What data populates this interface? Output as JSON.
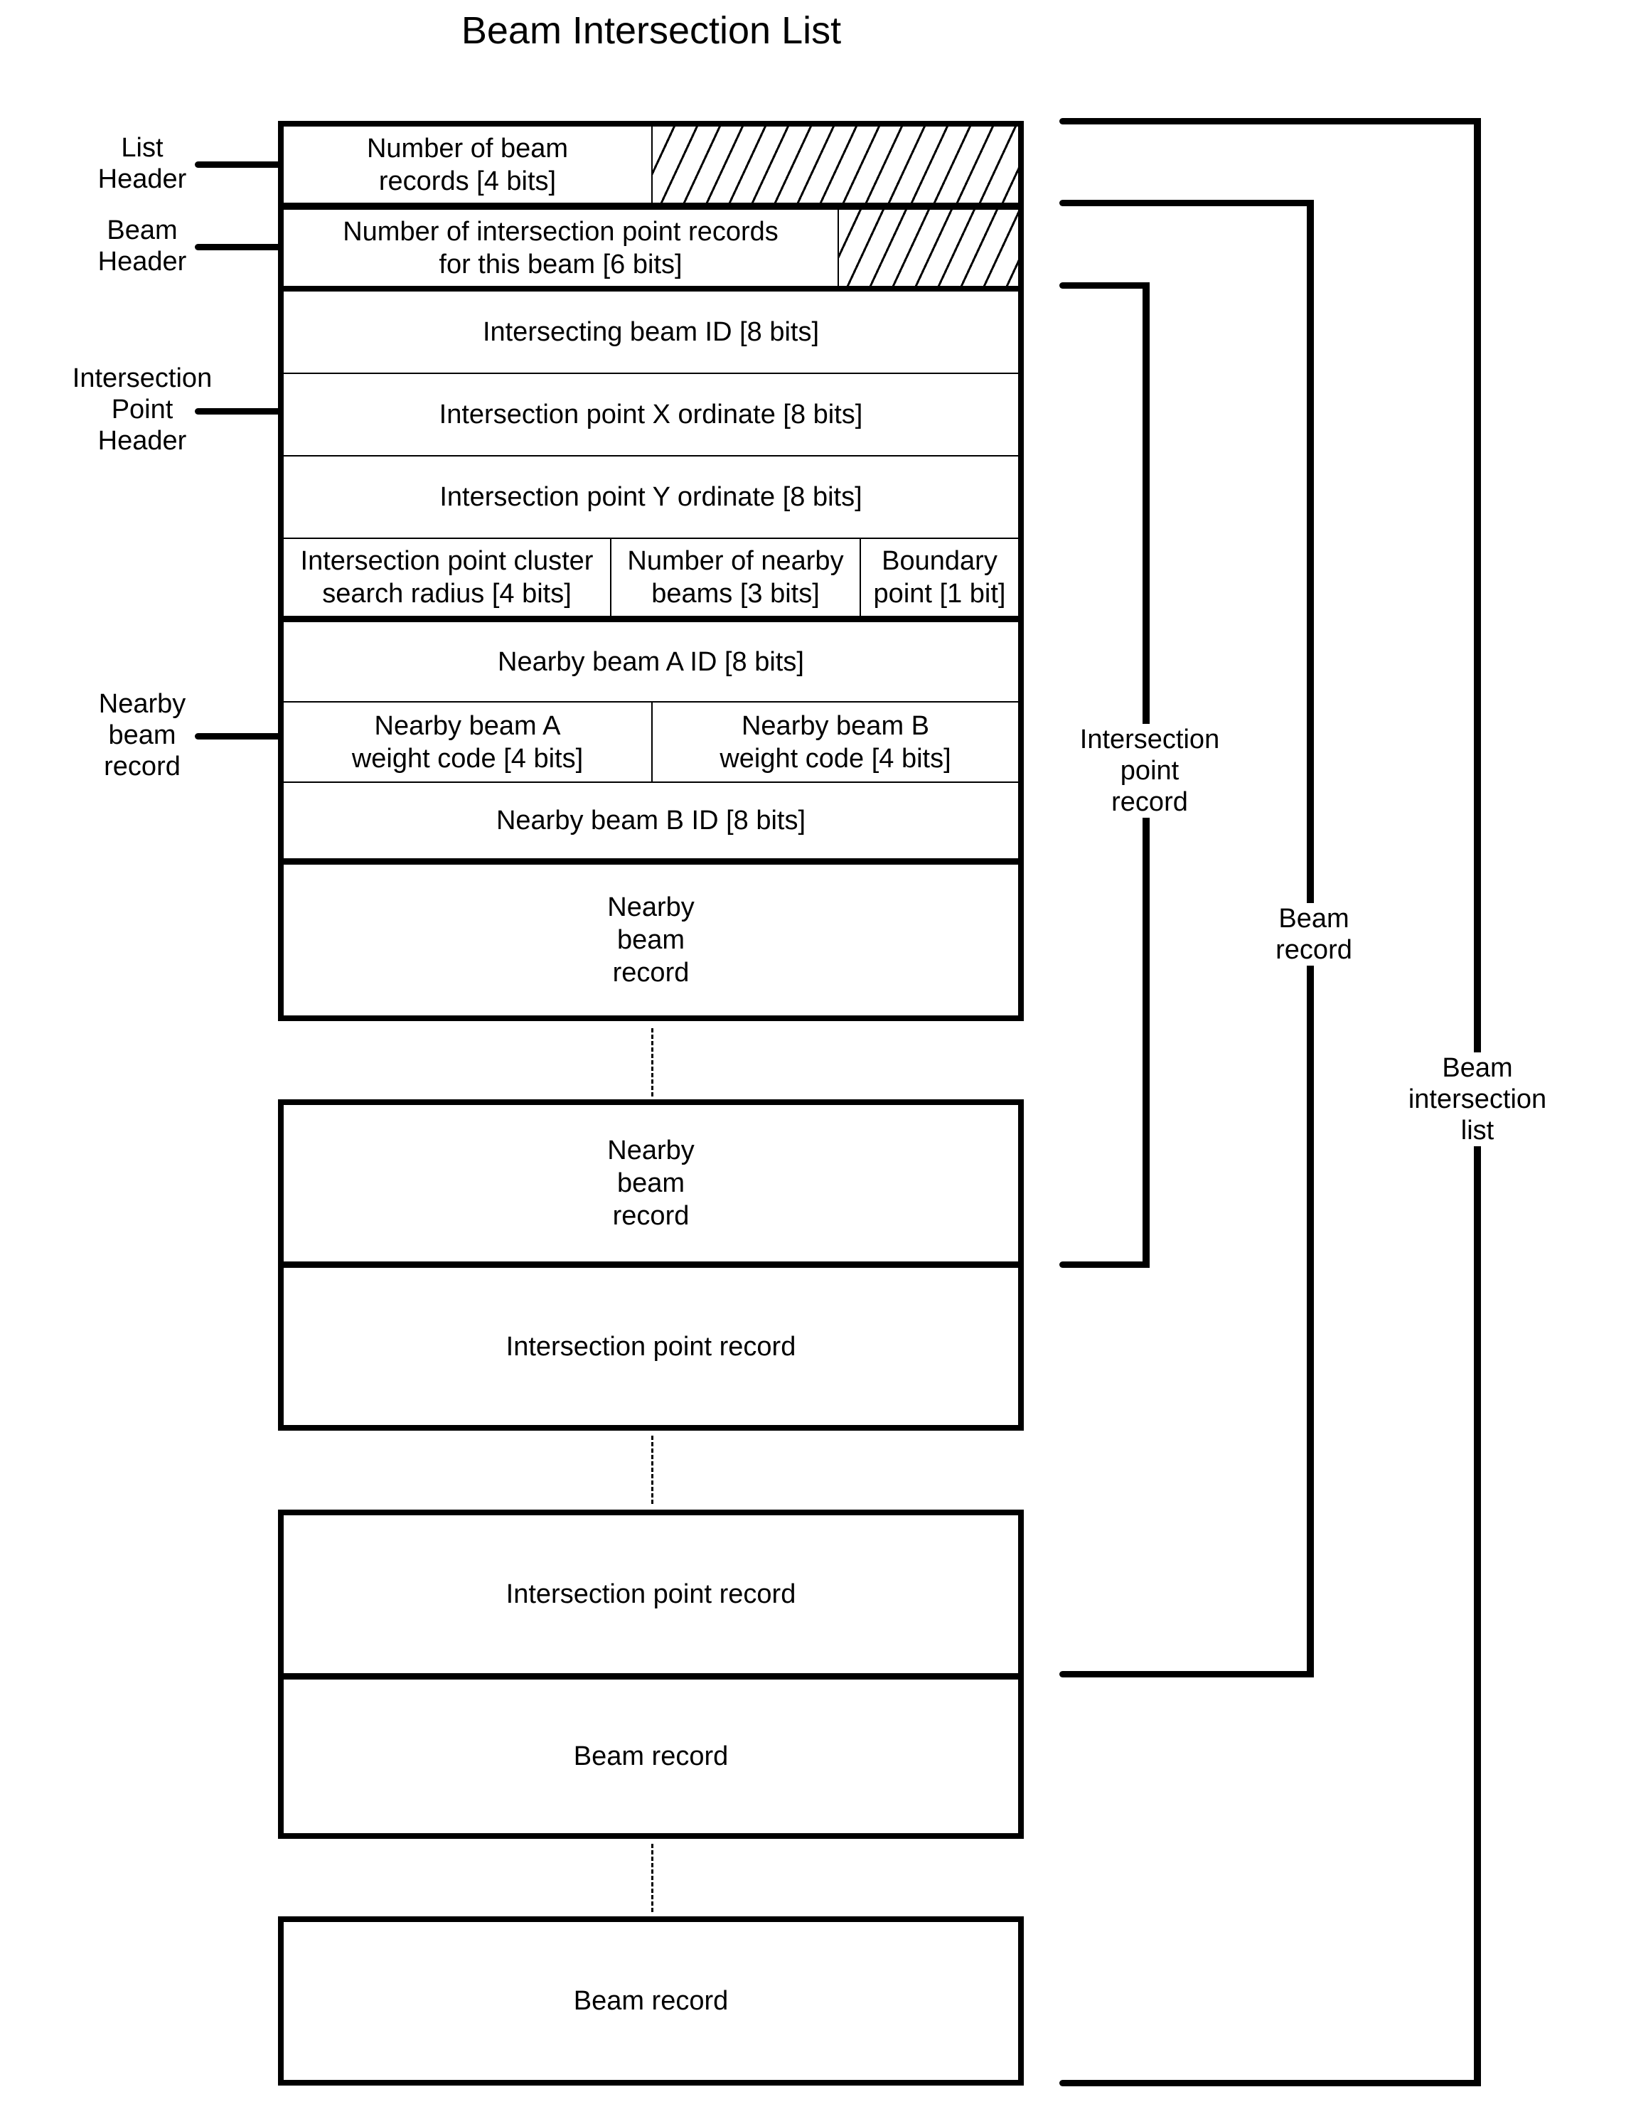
{
  "title": "Beam Intersection List",
  "left_labels": {
    "list_header": "List\nHeader",
    "beam_header": "Beam\nHeader",
    "intersection_point_header": "Intersection\nPoint\nHeader",
    "nearby_beam_record": "Nearby\nbeam\nrecord"
  },
  "fields": {
    "num_beam_records": "Number of beam\nrecords [4 bits]",
    "num_ip_records": "Number of intersection point records\nfor this beam [6 bits]",
    "intersecting_beam_id": "Intersecting beam ID [8 bits]",
    "ip_x": "Intersection point X ordinate [8 bits]",
    "ip_y": "Intersection point Y ordinate [8 bits]",
    "cluster_radius": "Intersection point cluster\nsearch radius [4 bits]",
    "num_nearby_beams": "Number of nearby\nbeams [3 bits]",
    "boundary_point": "Boundary\npoint [1 bit]",
    "nearby_a_id": "Nearby beam A ID [8 bits]",
    "nearby_a_weight": "Nearby beam A\nweight code [4 bits]",
    "nearby_b_weight": "Nearby beam B\nweight code [4 bits]",
    "nearby_b_id": "Nearby beam B ID [8 bits]"
  },
  "records": {
    "nearby_beam_record_1": "Nearby\nbeam\nrecord",
    "nearby_beam_record_2": "Nearby\nbeam\nrecord",
    "intersection_point_record_1": "Intersection point record",
    "intersection_point_record_2": "Intersection point record",
    "beam_record_1": "Beam record",
    "beam_record_2": "Beam record"
  },
  "right_labels": {
    "intersection_point_record": "Intersection\npoint\nrecord",
    "beam_record": "Beam\nrecord",
    "beam_intersection_list": "Beam\nintersection\nlist"
  }
}
